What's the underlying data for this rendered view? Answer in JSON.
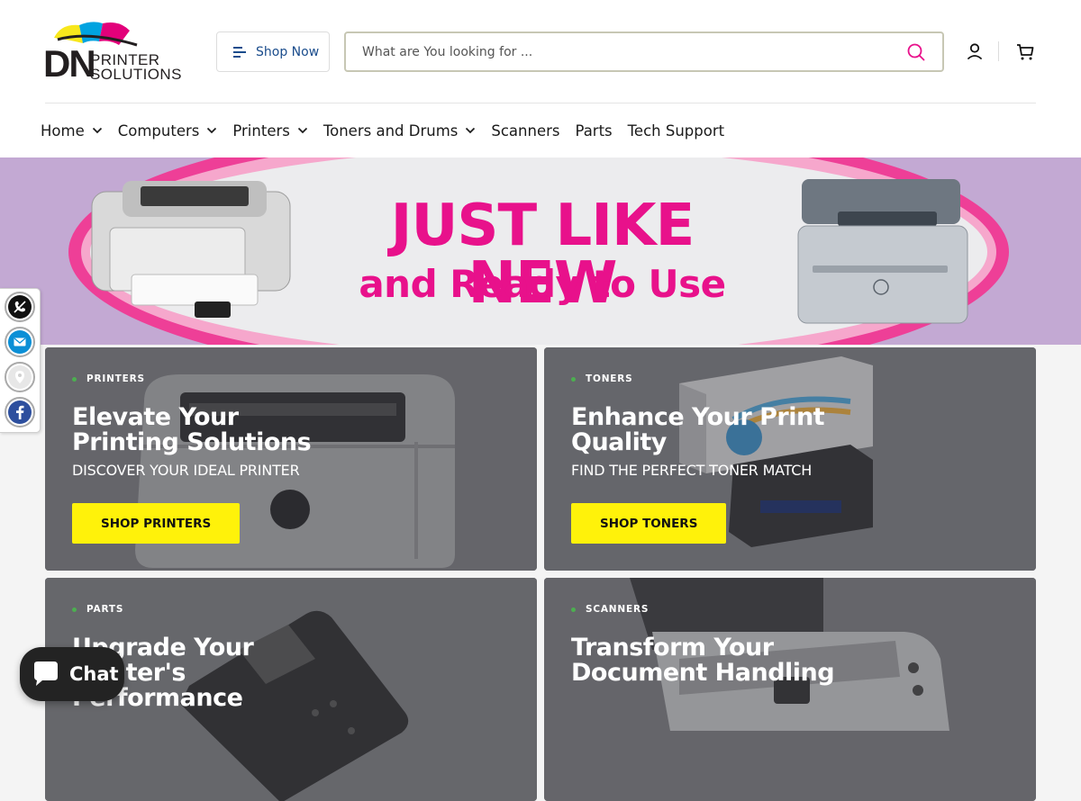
{
  "brand": {
    "logo_top": "DN",
    "logo_line1": "PRINTER",
    "logo_line2": "SOLUTIONS",
    "logo_colors": [
      "#f8e71c",
      "#00a3e0",
      "#e2007a"
    ]
  },
  "header": {
    "shop_now_label": "Shop Now",
    "search_placeholder": "What are You looking for ...",
    "search_value": "",
    "icons": [
      "menu-icon",
      "search-icon",
      "user-icon",
      "cart-icon"
    ]
  },
  "nav": {
    "items": [
      {
        "label": "Home",
        "has_dropdown": true
      },
      {
        "label": "Computers",
        "has_dropdown": true
      },
      {
        "label": "Printers",
        "has_dropdown": true
      },
      {
        "label": "Toners and Drums",
        "has_dropdown": true
      },
      {
        "label": "Scanners",
        "has_dropdown": false
      },
      {
        "label": "Parts",
        "has_dropdown": false
      },
      {
        "label": "Tech Support",
        "has_dropdown": false
      }
    ]
  },
  "hero": {
    "headline": "JUST LIKE NEW",
    "subheadline": "and Ready to Use",
    "accent_color": "#e8118b"
  },
  "social": {
    "items": [
      "phone-icon",
      "email-icon",
      "location-icon",
      "facebook-icon"
    ]
  },
  "cards": [
    {
      "eyebrow": "PRINTERS",
      "title": "Elevate Your Printing Solutions",
      "subtitle": "DISCOVER YOUR IDEAL PRINTER",
      "button": "SHOP PRINTERS"
    },
    {
      "eyebrow": "TONERS",
      "title": "Enhance Your Print Quality",
      "subtitle": "FIND THE PERFECT TONER MATCH",
      "button": "SHOP TONERS"
    },
    {
      "eyebrow": "PARTS",
      "title": "Upgrade Your Printer's Performance",
      "subtitle": "",
      "button": ""
    },
    {
      "eyebrow": "SCANNERS",
      "title": "Transform Your Document Handling",
      "subtitle": "",
      "button": ""
    }
  ],
  "chat": {
    "label": "Chat"
  },
  "colors": {
    "button_yellow": "#fff20a",
    "eyebrow_dot": "#4caf50",
    "link_blue": "#1a4c8c"
  }
}
